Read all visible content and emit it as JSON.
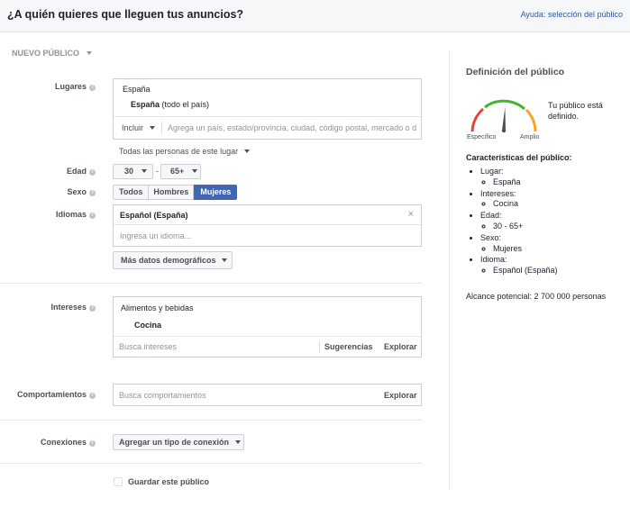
{
  "header": {
    "title": "¿A quién quieres que lleguen tus anuncios?",
    "help_link": "Ayuda: selección del público"
  },
  "audience_menu": {
    "label": "NUEVO PÚBLICO"
  },
  "locations": {
    "label": "Lugares",
    "country_header": "España",
    "selected_place": "España",
    "selected_place_note": "(todo el país)",
    "include_label": "Incluir",
    "input_placeholder": "Agrega un país, estado/provincia, ciudad, código postal, mercado o d",
    "people_filter": "Todas las personas de este lugar"
  },
  "age": {
    "label": "Edad",
    "min": "30",
    "separator": "-",
    "max": "65+"
  },
  "gender": {
    "label": "Sexo",
    "options": [
      "Todos",
      "Hombres",
      "Mujeres"
    ],
    "selected": "Mujeres"
  },
  "languages": {
    "label": "Idiomas",
    "selected": "Español (España)",
    "remove_symbol": "×",
    "input_placeholder": "Ingresa un idioma..."
  },
  "more_demographics": {
    "label": "Más datos demográficos"
  },
  "interests": {
    "label": "Intereses",
    "category": "Alimentos y bebidas",
    "selected": "Cocina",
    "input_placeholder": "Busca intereses",
    "suggestions_label": "Sugerencias",
    "explore_label": "Explorar"
  },
  "behaviors": {
    "label": "Comportamientos",
    "input_placeholder": "Busca comportamientos",
    "explore_label": "Explorar"
  },
  "connections": {
    "label": "Conexiones",
    "dropdown_label": "Agregar un tipo de conexión"
  },
  "save_audience": {
    "label": "Guardar este público"
  },
  "audience_definition": {
    "title": "Definición del público",
    "gauge_left": "Específico",
    "gauge_right": "Amplio",
    "gauge_level": 0.52,
    "status_text": "Tu público está definido.",
    "details_title": "Características del público:",
    "details": [
      {
        "name": "Lugar:",
        "value": "España"
      },
      {
        "name": "Intereses:",
        "value": "Cocina"
      },
      {
        "name": "Edad:",
        "value": "30 - 65+"
      },
      {
        "name": "Sexo:",
        "value": "Mujeres"
      },
      {
        "name": "Idioma:",
        "value": "Español (España)"
      }
    ],
    "potential_reach": "Alcance potencial: 2 700 000 personas"
  },
  "colors": {
    "accent": "#4267b2",
    "link": "#365899",
    "gauge_red": "#e0463d",
    "gauge_green": "#42b72a",
    "gauge_orange": "#f5a623"
  }
}
